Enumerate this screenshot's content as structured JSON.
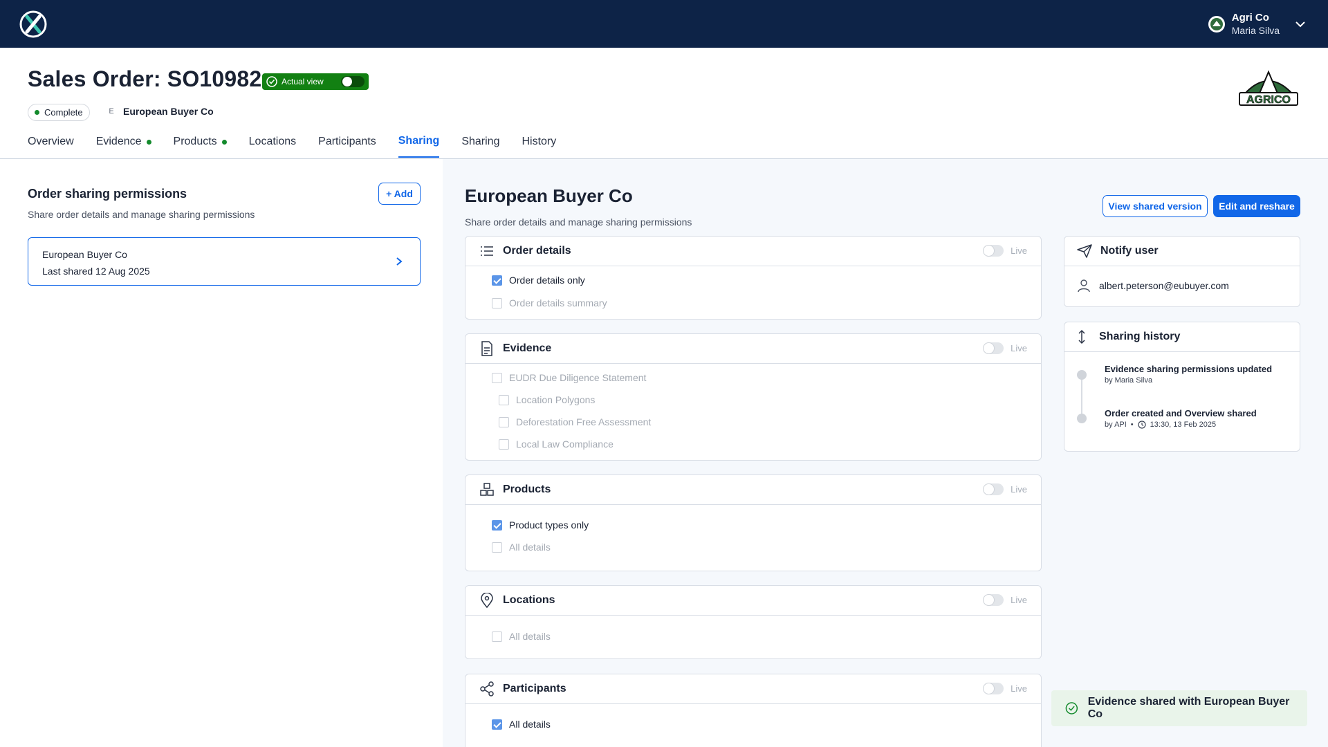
{
  "account": {
    "org": "Agri Co",
    "user": "Maria Silva"
  },
  "header": {
    "title": "Sales Order: SO10982",
    "actual_view_label": "Actual view",
    "status": "Complete",
    "buyer_initial": "E",
    "buyer": "European Buyer Co",
    "brand_logo_text": "AGRICO"
  },
  "tabs": [
    {
      "label": "Overview",
      "dot": false,
      "active": false
    },
    {
      "label": "Evidence",
      "dot": true,
      "active": false
    },
    {
      "label": "Products",
      "dot": true,
      "active": false
    },
    {
      "label": "Locations",
      "dot": false,
      "active": false
    },
    {
      "label": "Participants",
      "dot": false,
      "active": false
    },
    {
      "label": "Sharing",
      "dot": false,
      "active": true
    },
    {
      "label": "Sharing",
      "dot": false,
      "active": false
    },
    {
      "label": "History",
      "dot": false,
      "active": false
    }
  ],
  "left": {
    "title": "Order sharing permissions",
    "subtitle": "Share order details and manage sharing permissions",
    "add_label": "+ Add",
    "recipient": {
      "name": "European Buyer Co",
      "last_shared": "Last shared 12 Aug 2025"
    }
  },
  "right": {
    "title": "European Buyer Co",
    "subtitle": "Share order details and manage sharing permissions",
    "view_shared_label": "View shared version",
    "edit_reshare_label": "Edit and reshare",
    "live_label": "Live",
    "sections": {
      "order_details": {
        "title": "Order details",
        "options": [
          "Order details only",
          "Order details summary"
        ]
      },
      "evidence": {
        "title": "Evidence",
        "options": [
          "EUDR Due Diligence Statement",
          "Location Polygons",
          "Deforestation Free Assessment",
          "Local Law Compliance"
        ]
      },
      "products": {
        "title": "Products",
        "options": [
          "Product types only",
          "All details"
        ]
      },
      "locations": {
        "title": "Locations",
        "options": [
          "All details"
        ]
      },
      "participants": {
        "title": "Participants",
        "options": [
          "All details"
        ]
      }
    }
  },
  "notify": {
    "title": "Notify user",
    "email": "albert.peterson@eubuyer.com"
  },
  "history": {
    "title": "Sharing history",
    "items": [
      {
        "title": "Evidence sharing permissions updated",
        "by": "by Maria Silva"
      },
      {
        "title": "Order created and Overview shared",
        "by": "by API",
        "time": "13:30, 13 Feb 2025"
      }
    ]
  },
  "toast": {
    "message": "Evidence shared with European Buyer Co"
  },
  "colors": {
    "navy": "#0d2347",
    "primary": "#1167e8",
    "success": "#128012",
    "status_dot": "#138a2c"
  },
  "icons": [
    "app-logo-icon",
    "avatar-icon",
    "chevron-down-icon",
    "check-circle-icon",
    "chevron-right-icon",
    "list-icon",
    "document-icon",
    "boxes-icon",
    "location-pin-icon",
    "share-icon",
    "send-icon",
    "user-icon",
    "vertical-arrows-icon",
    "clock-icon"
  ]
}
